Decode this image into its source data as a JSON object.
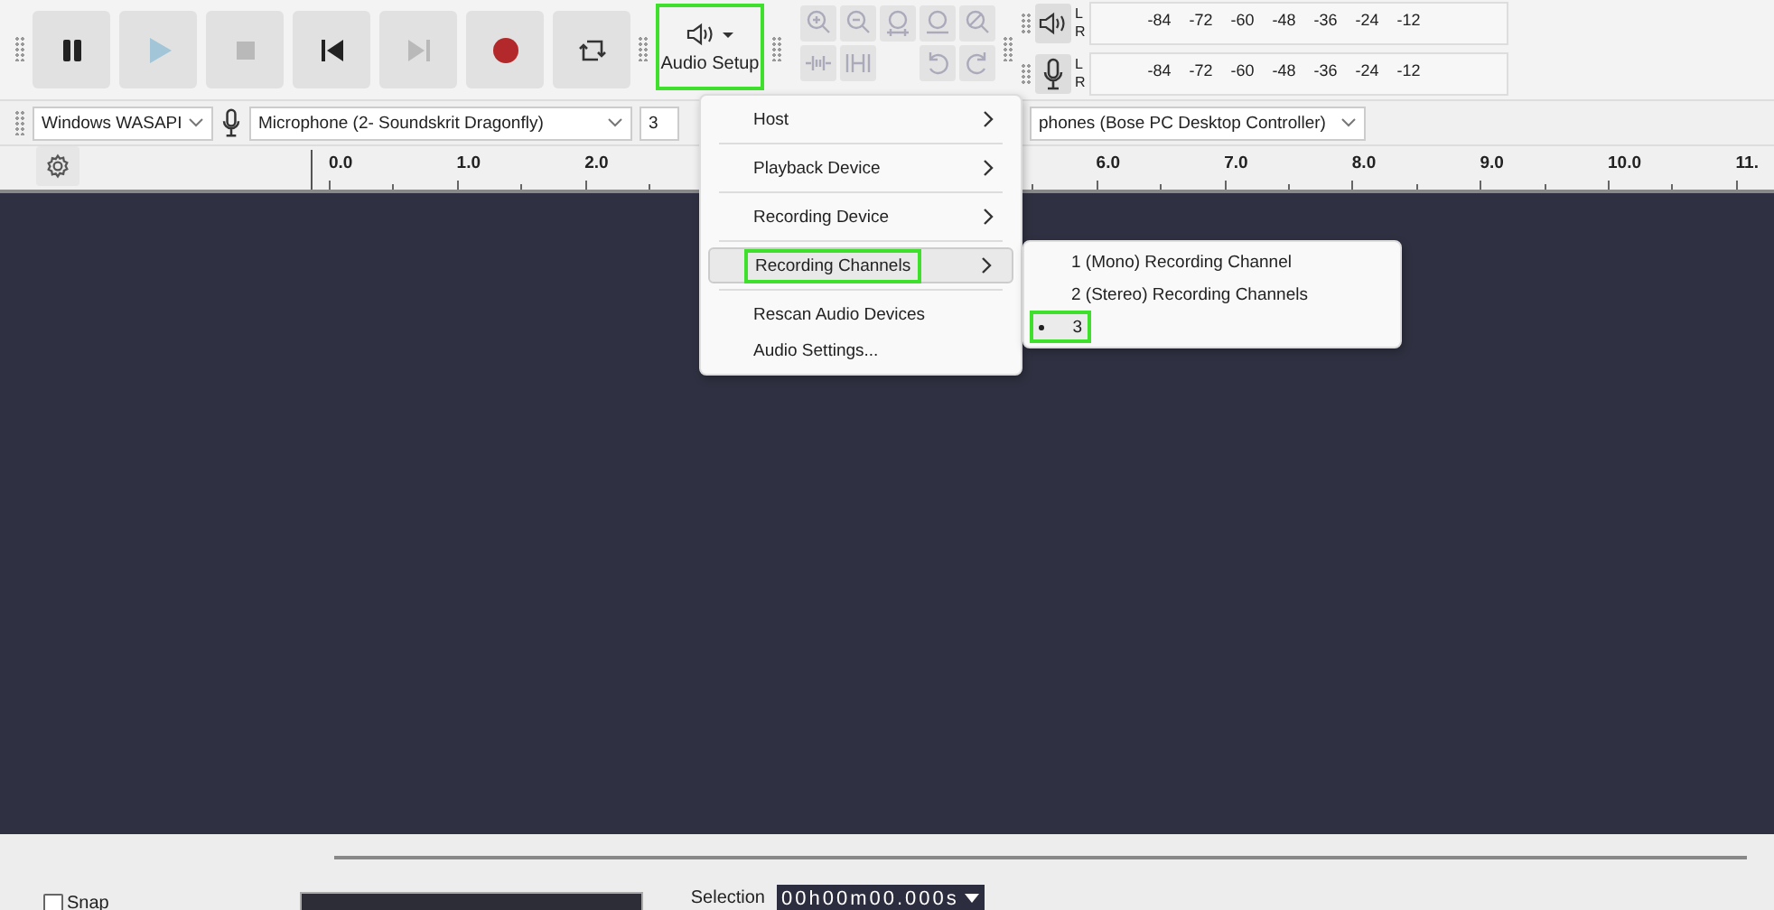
{
  "transport": [
    {
      "kind": "pause",
      "disabled": false
    },
    {
      "kind": "play",
      "disabled": true
    },
    {
      "kind": "stop",
      "disabled": true
    },
    {
      "kind": "skip-start",
      "disabled": false
    },
    {
      "kind": "skip-end",
      "disabled": true
    },
    {
      "kind": "record",
      "disabled": false
    },
    {
      "kind": "loop",
      "disabled": false
    }
  ],
  "audio_setup": {
    "label": "Audio Setup",
    "highlighted": true
  },
  "tools": [
    {
      "kind": "zoom-in"
    },
    {
      "kind": "zoom-out"
    },
    {
      "kind": "fit-selection"
    },
    {
      "kind": "fit-project"
    },
    {
      "kind": "zoom-toggle"
    },
    {
      "kind": "trim"
    },
    {
      "kind": "silence"
    },
    {
      "kind": "undo"
    },
    {
      "kind": "redo"
    }
  ],
  "meters": [
    {
      "kind": "playback",
      "channels": [
        "L",
        "R"
      ],
      "scale": [
        "-84",
        "-72",
        "-60",
        "-48",
        "-36",
        "-24",
        "-12"
      ]
    },
    {
      "kind": "recording",
      "channels": [
        "L",
        "R"
      ],
      "scale": [
        "-84",
        "-72",
        "-60",
        "-48",
        "-36",
        "-24",
        "-12"
      ]
    }
  ],
  "device_bar": {
    "host": "Windows WASAPI",
    "recording_device": "Microphone (2- Soundskrit Dragonfly)",
    "recording_channels": "3",
    "playback_device": "phones (Bose PC Desktop Controller)"
  },
  "ruler": {
    "ticks": [
      "0.0",
      "1.0",
      "2.0",
      "6.0",
      "7.0",
      "8.0",
      "9.0",
      "10.0",
      "11."
    ]
  },
  "menu": {
    "items": [
      {
        "label": "Host",
        "submenu": true,
        "selected": false,
        "highlighted": false,
        "separator_after": true
      },
      {
        "label": "Playback Device",
        "submenu": true,
        "selected": false,
        "highlighted": false,
        "separator_after": true
      },
      {
        "label": "Recording Device",
        "submenu": true,
        "selected": false,
        "highlighted": false,
        "separator_after": true
      },
      {
        "label": "Recording Channels",
        "submenu": true,
        "selected": true,
        "highlighted": true,
        "separator_after": true
      },
      {
        "label": "Rescan Audio Devices",
        "submenu": false,
        "selected": false,
        "highlighted": false,
        "separator_after": false
      },
      {
        "label": "Audio Settings...",
        "submenu": false,
        "selected": false,
        "highlighted": false,
        "separator_after": false
      }
    ]
  },
  "submenu": {
    "items": [
      {
        "label": "1 (Mono) Recording Channel",
        "checked": false,
        "selected": false,
        "highlighted": false
      },
      {
        "label": "2 (Stereo) Recording Channels",
        "checked": false,
        "selected": false,
        "highlighted": false
      },
      {
        "label": "3",
        "checked": true,
        "selected": true,
        "highlighted": true
      }
    ]
  },
  "snap": {
    "label": "Snap",
    "checked": false
  },
  "selection": {
    "label": "Selection",
    "value": "00h00m00.000s"
  }
}
